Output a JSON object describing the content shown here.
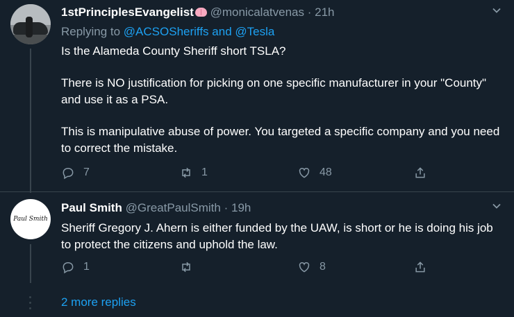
{
  "tweets": [
    {
      "name": "1stPrinciplesEvangelist",
      "name_emoji": "brain-emoji",
      "handle": "@monicalatvenas",
      "separator": "·",
      "time": "21h",
      "replying_prefix": "Replying to",
      "reply_user_1": "@ACSOSheriffs",
      "reply_and": "and",
      "reply_user_2": "@Tesla",
      "paragraphs": [
        "Is the Alameda County Sheriff  short TSLA?",
        "There is NO justification for picking on one specific manufacturer in your \"County\" and use it as a PSA.",
        "This is manipulative abuse of power.  You targeted a specific company and you need to correct the mistake."
      ],
      "replies": "7",
      "retweets": "1",
      "likes": "48"
    },
    {
      "name": "Paul Smith",
      "handle": "@GreatPaulSmith",
      "separator": "·",
      "time": "19h",
      "avatar_text": "Paul Smith",
      "paragraphs": [
        "Sheriff Gregory J. Ahern is either funded by the UAW, is short or he is doing his job to protect the citizens and uphold the law."
      ],
      "replies": "1",
      "retweets": "",
      "likes": "8"
    }
  ],
  "more_replies": "2 more replies",
  "colors": {
    "background": "#15202b",
    "accent": "#1da1f2",
    "muted": "#8899a6",
    "border": "#38444d"
  },
  "icons": [
    "reply-icon",
    "retweet-icon",
    "like-icon",
    "share-icon",
    "chevron-down-icon"
  ]
}
